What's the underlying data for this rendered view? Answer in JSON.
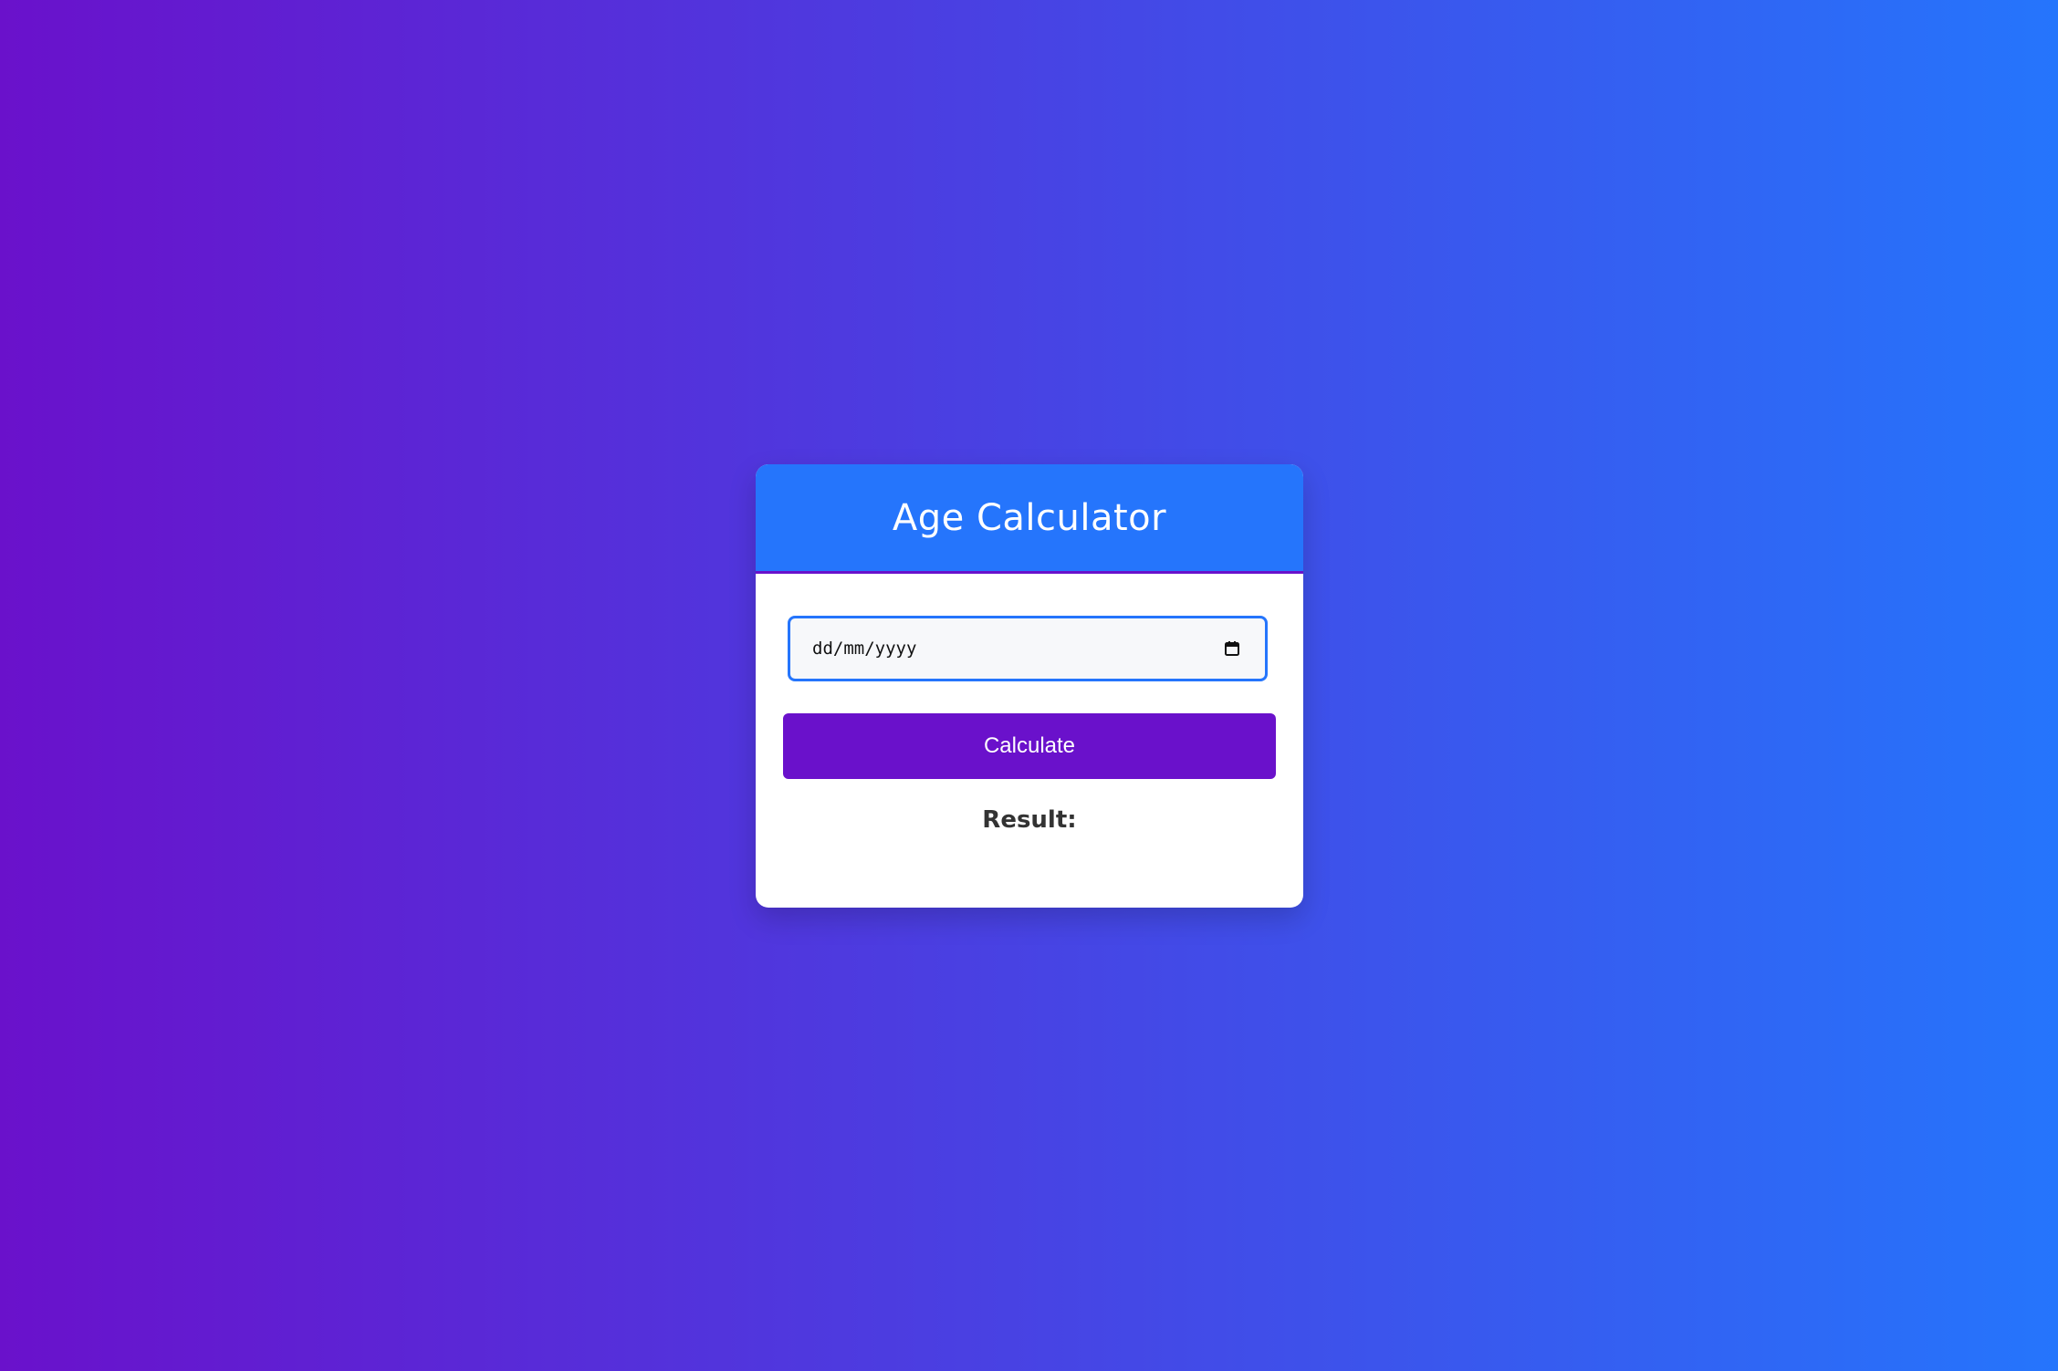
{
  "app": {
    "title": "Age Calculator"
  },
  "form": {
    "date_input": {
      "placeholder_display": "dd/mm/yyyy",
      "value": "",
      "icon": "calendar-icon"
    },
    "calculate_label": "Calculate"
  },
  "result": {
    "label": "Result:",
    "value": ""
  },
  "colors": {
    "gradient_start": "#6a11cb",
    "gradient_end": "#2575fc",
    "header": "#2575fc",
    "button": "#6a11cb",
    "card": "#ffffff"
  }
}
